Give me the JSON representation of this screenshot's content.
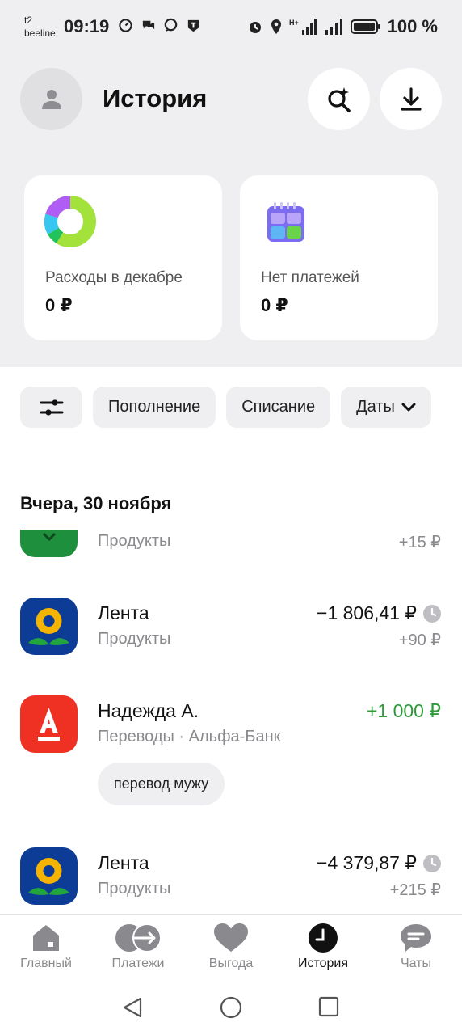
{
  "status_bar": {
    "carrier1": "t2",
    "carrier2": "beeline",
    "time": "09:19",
    "network": "H+",
    "battery": "100 %"
  },
  "header": {
    "title": "История"
  },
  "cards": [
    {
      "label": "Расходы в декабре",
      "value": "0 ₽",
      "icon": "donut-chart-icon"
    },
    {
      "label": "Нет платежей",
      "value": "0 ₽",
      "icon": "calendar-icon"
    }
  ],
  "filters": {
    "settings_icon": "sliders-icon",
    "chips": [
      "Пополнение",
      "Списание",
      "Даты"
    ]
  },
  "date_header": "Вчера, 30 ноября",
  "transactions": [
    {
      "name": "",
      "category": "Продукты",
      "amount": "",
      "cashback": "+15 ₽",
      "logo": "green-logo"
    },
    {
      "name": "Лента",
      "category": "Продукты",
      "amount": "−1 806,41 ₽",
      "cashback": "+90 ₽",
      "logo": "lenta-logo",
      "pending": true
    },
    {
      "name": "Надежда А.",
      "category": "Переводы · Альфа-Банк",
      "amount": "+1 000 ₽",
      "cashback": "",
      "logo": "alfa-logo",
      "note": "перевод мужу"
    },
    {
      "name": "Лента",
      "category": "Продукты",
      "amount": "−4 379,87 ₽",
      "cashback": "+215 ₽",
      "logo": "lenta-logo",
      "pending": true
    }
  ],
  "bottom_nav": [
    {
      "label": "Главный",
      "icon": "home-icon"
    },
    {
      "label": "Платежи",
      "icon": "payments-icon"
    },
    {
      "label": "Выгода",
      "icon": "heart-icon"
    },
    {
      "label": "История",
      "icon": "history-clock-icon",
      "active": true
    },
    {
      "label": "Чаты",
      "icon": "chat-icon"
    }
  ],
  "colors": {
    "background_gray": "#efeff1",
    "positive_green": "#2e9a3a",
    "lenta_blue": "#0d3c97",
    "lenta_yellow": "#f4b400",
    "alfa_red": "#ef3124"
  }
}
